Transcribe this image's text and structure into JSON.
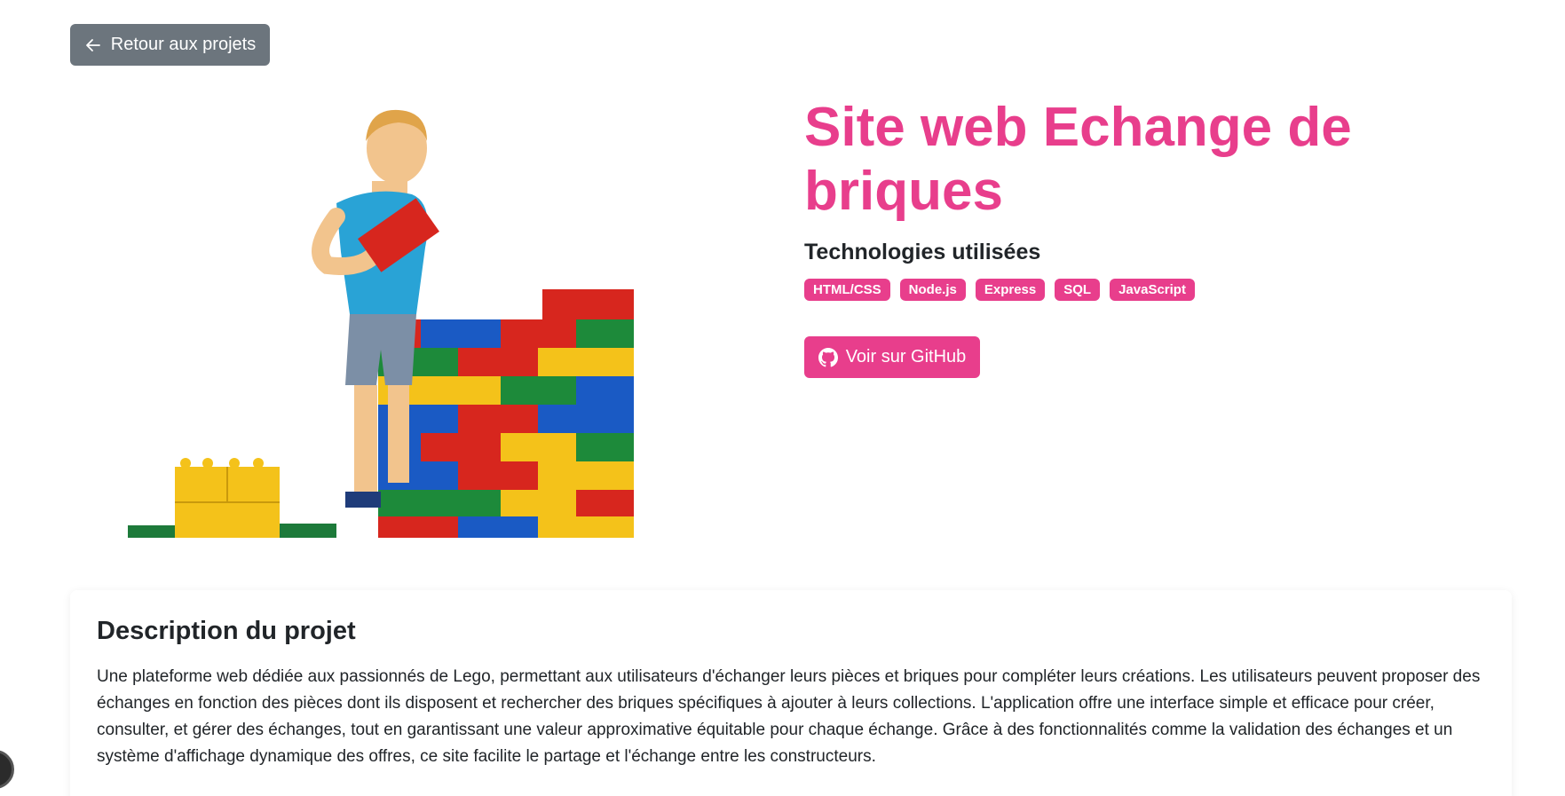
{
  "nav": {
    "back_label": "Retour aux projets"
  },
  "project": {
    "title": "Site web Echange de briques",
    "tech_heading": "Technologies utilisées",
    "technologies": [
      "HTML/CSS",
      "Node.js",
      "Express",
      "SQL",
      "JavaScript"
    ],
    "github_label": "Voir sur GitHub"
  },
  "description": {
    "heading": "Description du projet",
    "text": "Une plateforme web dédiée aux passionnés de Lego, permettant aux utilisateurs d'échanger leurs pièces et briques pour compléter leurs créations. Les utilisateurs peuvent proposer des échanges en fonction des pièces dont ils disposent et rechercher des briques spécifiques à ajouter à leurs collections. L'application offre une interface simple et efficace pour créer, consulter, et gérer des échanges, tout en garantissant une valeur approximative équitable pour chaque échange. Grâce à des fonctionnalités comme la validation des échanges et un système d'affichage dynamique des offres, ce site facilite le partage et l'échange entre les constructeurs."
  },
  "colors": {
    "accent": "#e83e8c",
    "secondary_button": "#6c757d",
    "text": "#212529"
  },
  "icons": {
    "back": "arrow-left-icon",
    "github": "github-icon"
  }
}
